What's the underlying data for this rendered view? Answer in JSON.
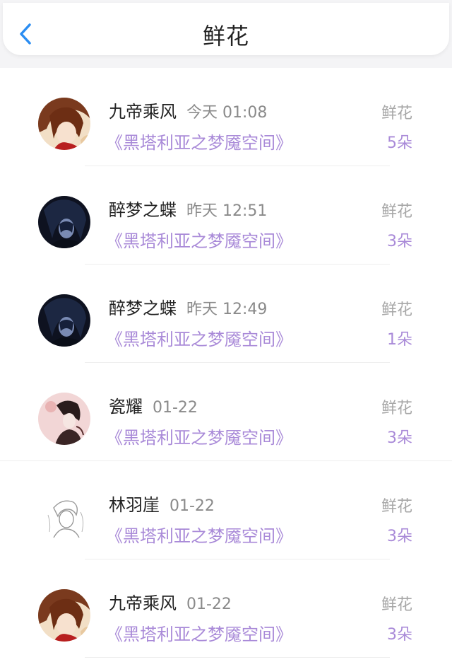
{
  "header": {
    "title": "鲜花",
    "back_icon": "chevron-left-icon",
    "accent": "#2a8df2"
  },
  "colors": {
    "accent_purple": "#a98ad8",
    "secondary_gray": "#8a8a8a"
  },
  "rows": [
    {
      "name": "九帝乘风",
      "time": "今天 01:08",
      "book": "《黑塔利亚之梦魇空间》",
      "type": "鲜花",
      "qty": "5朵",
      "avatar": "avatar-brown-hair"
    },
    {
      "name": "醉梦之蝶",
      "time": "昨天 12:51",
      "book": "《黑塔利亚之梦魇空间》",
      "type": "鲜花",
      "qty": "3朵",
      "avatar": "avatar-dark-hair"
    },
    {
      "name": "醉梦之蝶",
      "time": "昨天 12:49",
      "book": "《黑塔利亚之梦魇空间》",
      "type": "鲜花",
      "qty": "1朵",
      "avatar": "avatar-dark-hair"
    },
    {
      "name": "瓷耀",
      "time": "01-22",
      "book": "《黑塔利亚之梦魇空间》",
      "type": "鲜花",
      "qty": "3朵",
      "avatar": "avatar-pink-bg"
    },
    {
      "name": "林羽崖",
      "time": "01-22",
      "book": "《黑塔利亚之梦魇空间》",
      "type": "鲜花",
      "qty": "3朵",
      "avatar": "avatar-sketch"
    },
    {
      "name": "九帝乘风",
      "time": "01-22",
      "book": "《黑塔利亚之梦魇空间》",
      "type": "鲜花",
      "qty": "3朵",
      "avatar": "avatar-brown-hair"
    }
  ]
}
